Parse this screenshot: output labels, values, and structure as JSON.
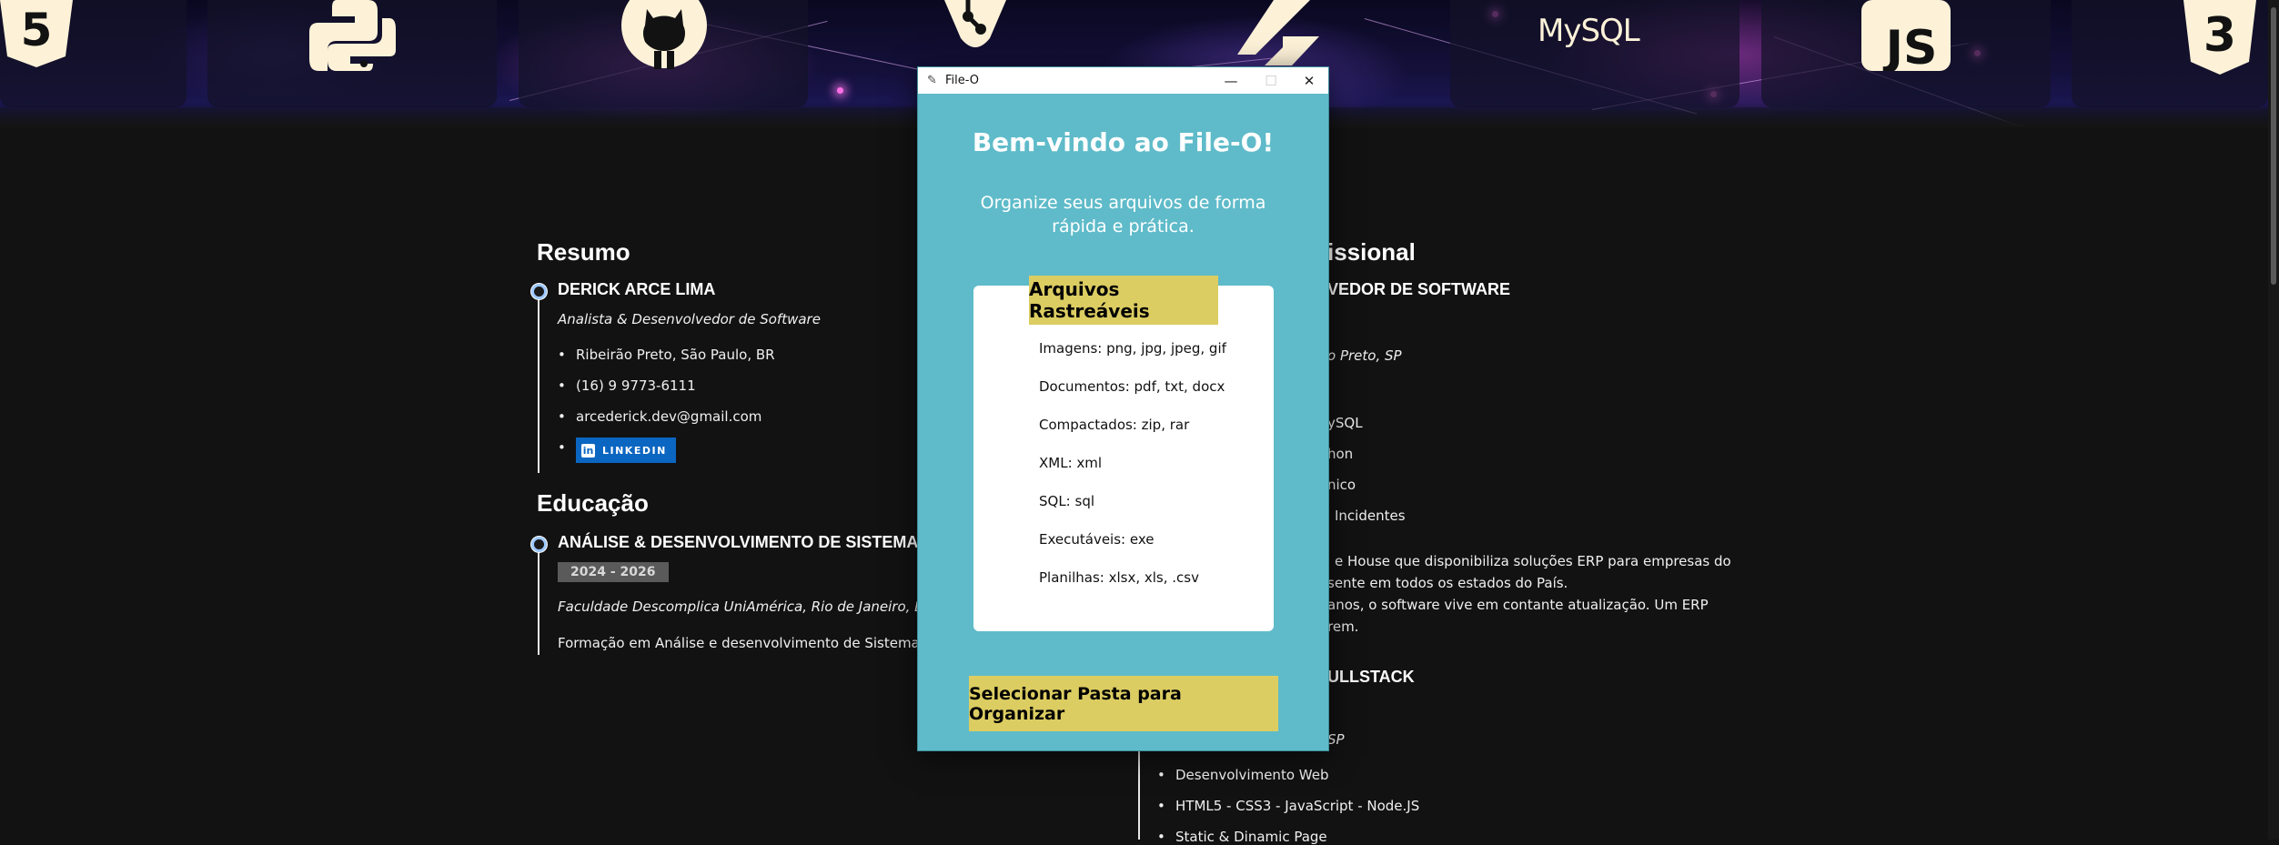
{
  "banner": {
    "techs": [
      {
        "name": "HTML5",
        "icon": "html5-icon"
      },
      {
        "name": "Python",
        "icon": "python-icon"
      },
      {
        "name": "GitHub",
        "icon": "github-icon"
      },
      {
        "name": "Git",
        "icon": "git-icon"
      },
      {
        "name": "Flutter",
        "icon": "flutter-icon"
      },
      {
        "name": "MySQL",
        "icon": "mysql-icon"
      },
      {
        "name": "JS",
        "icon": "javascript-icon"
      },
      {
        "name": "CSS3",
        "icon": "css3-icon"
      }
    ]
  },
  "resume": {
    "resumo_title": "Resumo",
    "name": "DERICK ARCE LIMA",
    "role": "Analista & Desenvolvedor de Software",
    "contacts": [
      "Ribeirão Preto, São Paulo, BR",
      "(16) 9 9773-6111",
      "arcederick.dev@gmail.com"
    ],
    "linkedin_label": "LINKEDIN",
    "education_title": "Educação",
    "course": "ANÁLISE & DESENVOLVIMENTO DE SISTEMA",
    "years": "2024 - 2026",
    "school": "Faculdade Descomplica UniAmérica, Rio de Janeiro, BR",
    "course_desc": "Formação em Análise e desenvolvimento de Sistemas"
  },
  "experience": {
    "title_fragment": "issional",
    "job1_fragment": "VEDOR DE SOFTWARE",
    "job1_location_fragment": "o Preto, SP",
    "job1_items_fragments": [
      "ySQL",
      "hon",
      "nico",
      "Incidentes"
    ],
    "job1_desc_fragments": [
      "e House que disponibiliza soluções ERP para empresas do",
      "sente em todos os estados do País.",
      "anos, o software vive em contante atualização. Um ERP",
      "rem."
    ],
    "job2_fragment": "ULLSTACK",
    "job2_location_fragment": "SP",
    "job2_items": [
      "Desenvolvimento Web",
      "HTML5 - CSS3 - JavaScript - Node.JS",
      "Static & Dinamic Page"
    ]
  },
  "dialog": {
    "window_title": "File-O",
    "heading": "Bem-vindo ao File-O!",
    "description": "Organize seus arquivos de forma rápida e prática.",
    "card_title": "Arquivos Rastreáveis",
    "file_types": [
      "Imagens: png, jpg, jpeg, gif",
      "Documentos: pdf, txt, docx",
      "Compactados: zip, rar",
      "XML: xml",
      "SQL: sql",
      "Executáveis: exe",
      "Planilhas: xlsx, xls, .csv"
    ],
    "select_button": "Selecionar Pasta para Organizar",
    "colors": {
      "background": "#5fbbc9",
      "accent": "#dccd62"
    }
  }
}
